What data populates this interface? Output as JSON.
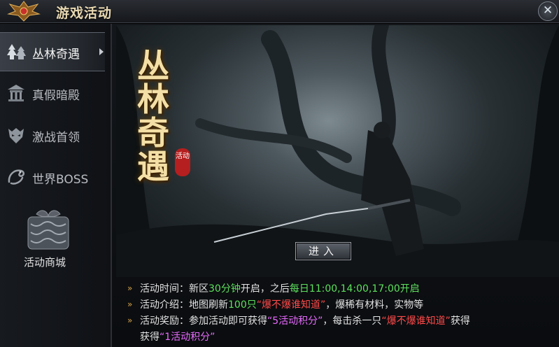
{
  "window": {
    "title": "游戏活动",
    "close_glyph": "✕"
  },
  "sidebar": {
    "items": [
      {
        "label": "丛林奇遇",
        "icon": "forest-icon"
      },
      {
        "label": "真假暗殿",
        "icon": "temple-icon"
      },
      {
        "label": "激战首领",
        "icon": "demon-mask-icon"
      },
      {
        "label": "世界BOSS",
        "icon": "dragon-icon"
      }
    ],
    "shop": {
      "label": "活动商城",
      "icon": "gift-box-icon"
    }
  },
  "banner": {
    "title": "丛林奇遇",
    "badge": "活动",
    "enter_button": "进入"
  },
  "info": {
    "time_label": "活动时间：",
    "time_p1": "新区",
    "time_p2": "30分钟",
    "time_p3": "开启，之后",
    "time_p4": "每日11:00,14:00,17:00开启",
    "intro_label": "活动介绍：",
    "intro_p1": "地图刷新",
    "intro_p2": "100只",
    "intro_p3": "“爆不爆谁知道”",
    "intro_p4": "，爆稀有材料，实物等",
    "reward_label": "活动奖励：",
    "reward_p1": "参加活动即可获得",
    "reward_p2": "“5活动积分”",
    "reward_p3": "，每击杀一只",
    "reward_p4": "“爆不爆谁知道”",
    "reward_p5": "获得",
    "reward_p6": "获得",
    "reward_p7": "“1活动积分”"
  },
  "colors": {
    "accent_gold": "#f4e0a6",
    "highlight_green": "#5ee05e",
    "highlight_red": "#ff4a4a",
    "highlight_pink": "#e86bff"
  }
}
